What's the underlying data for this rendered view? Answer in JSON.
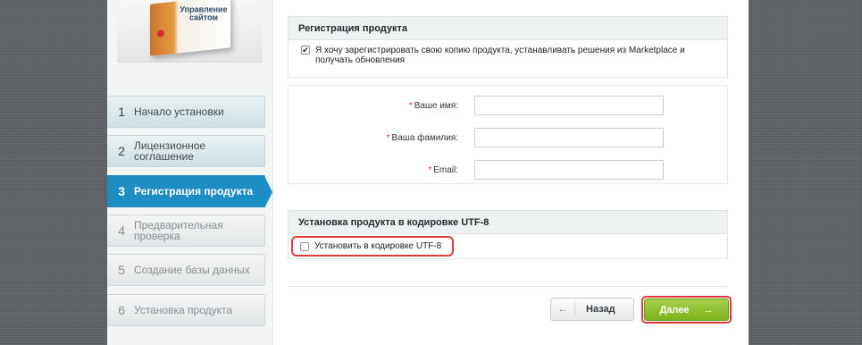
{
  "product": {
    "box_title": "Управление сайтом"
  },
  "steps": [
    {
      "num": "1",
      "label": "Начало установки",
      "state": "done"
    },
    {
      "num": "2",
      "label": "Лицензионное соглашение",
      "state": "done"
    },
    {
      "num": "3",
      "label": "Регистрация продукта",
      "state": "active"
    },
    {
      "num": "4",
      "label": "Предварительная проверка",
      "state": "disabled"
    },
    {
      "num": "5",
      "label": "Создание базы данных",
      "state": "disabled"
    },
    {
      "num": "6",
      "label": "Установка продукта",
      "state": "disabled"
    }
  ],
  "registration": {
    "title": "Регистрация продукта",
    "consent_checked": true,
    "consent_text": "Я хочу зарегистрировать свою копию продукта, устанавливать решения из Marketplace и получать обновления"
  },
  "form": {
    "required_mark": "*",
    "first_name_label": "Ваше имя:",
    "first_name_value": "",
    "last_name_label": "Ваша фамилия:",
    "last_name_value": "",
    "email_label": "Email:",
    "email_value": ""
  },
  "utf": {
    "title": "Установка продукта в кодировке UTF-8",
    "checkbox_label": "Установить в кодировке UTF-8",
    "checked": false
  },
  "buttons": {
    "back_label": "Назад",
    "back_arrow": "←",
    "next_label": "Далее",
    "next_arrow": "→"
  },
  "colors": {
    "active_step": "#1e8dc4",
    "next_button": "#8cc43a",
    "highlight": "#e23a3a",
    "required": "#e0322a"
  }
}
